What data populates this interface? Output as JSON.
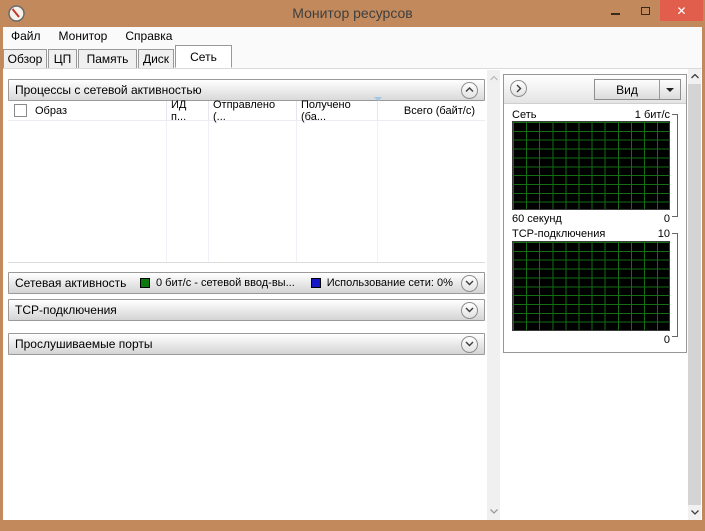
{
  "window": {
    "title": "Монитор ресурсов",
    "controls": {
      "minimize": "minimize",
      "maximize": "maximize",
      "close": "close"
    }
  },
  "menubar": {
    "items": [
      {
        "label": "Файл"
      },
      {
        "label": "Монитор"
      },
      {
        "label": "Справка"
      }
    ]
  },
  "tabs": [
    {
      "label": "Обзор",
      "active": false
    },
    {
      "label": "ЦП",
      "active": false
    },
    {
      "label": "Память",
      "active": false
    },
    {
      "label": "Диск",
      "active": false
    },
    {
      "label": "Сеть",
      "active": true
    }
  ],
  "processes_panel": {
    "title": "Процессы с сетевой активностью",
    "columns": [
      {
        "label": "Образ"
      },
      {
        "label": "ИД п..."
      },
      {
        "label": "Отправлено (..."
      },
      {
        "label": "Получено (ба..."
      },
      {
        "label": "Всего (байт/с)"
      }
    ],
    "rows": []
  },
  "network_activity_panel": {
    "title": "Сетевая активность",
    "legend": [
      {
        "color": "#0b7a0b",
        "label": "0 бит/с - сетевой ввод-вы..."
      },
      {
        "color": "#1515c8",
        "label": "Использование сети: 0%"
      }
    ]
  },
  "tcp_panel": {
    "title": "TCP-подключения"
  },
  "ports_panel": {
    "title": "Прослушиваемые порты"
  },
  "side_panel": {
    "view_button": {
      "label": "Вид"
    },
    "charts": [
      {
        "title": "Сеть",
        "y_max": "1 бит/с",
        "y_min": "0",
        "x_label": "60 секунд"
      },
      {
        "title": "TCP-подключения",
        "y_max": "10",
        "y_min": "0"
      }
    ]
  },
  "chart_data": [
    {
      "type": "area",
      "title": "Сеть",
      "ylabel_top": "1 бит/с",
      "ylim": [
        0,
        1
      ],
      "x_range_label": "60 секунд",
      "grid": true,
      "series": [
        {
          "name": "Сеть",
          "values": [
            0
          ]
        }
      ]
    },
    {
      "type": "area",
      "title": "TCP-подключения",
      "ylim": [
        0,
        10
      ],
      "grid": true,
      "series": [
        {
          "name": "TCP-подключения",
          "values": [
            0
          ]
        }
      ]
    }
  ],
  "colors": {
    "window_frame": "#c28a5c",
    "close_button": "#e25e4c",
    "chart_background": "#000000",
    "chart_grid": "#146e14",
    "legend_green": "#0b7a0b",
    "legend_blue": "#1515c8"
  }
}
